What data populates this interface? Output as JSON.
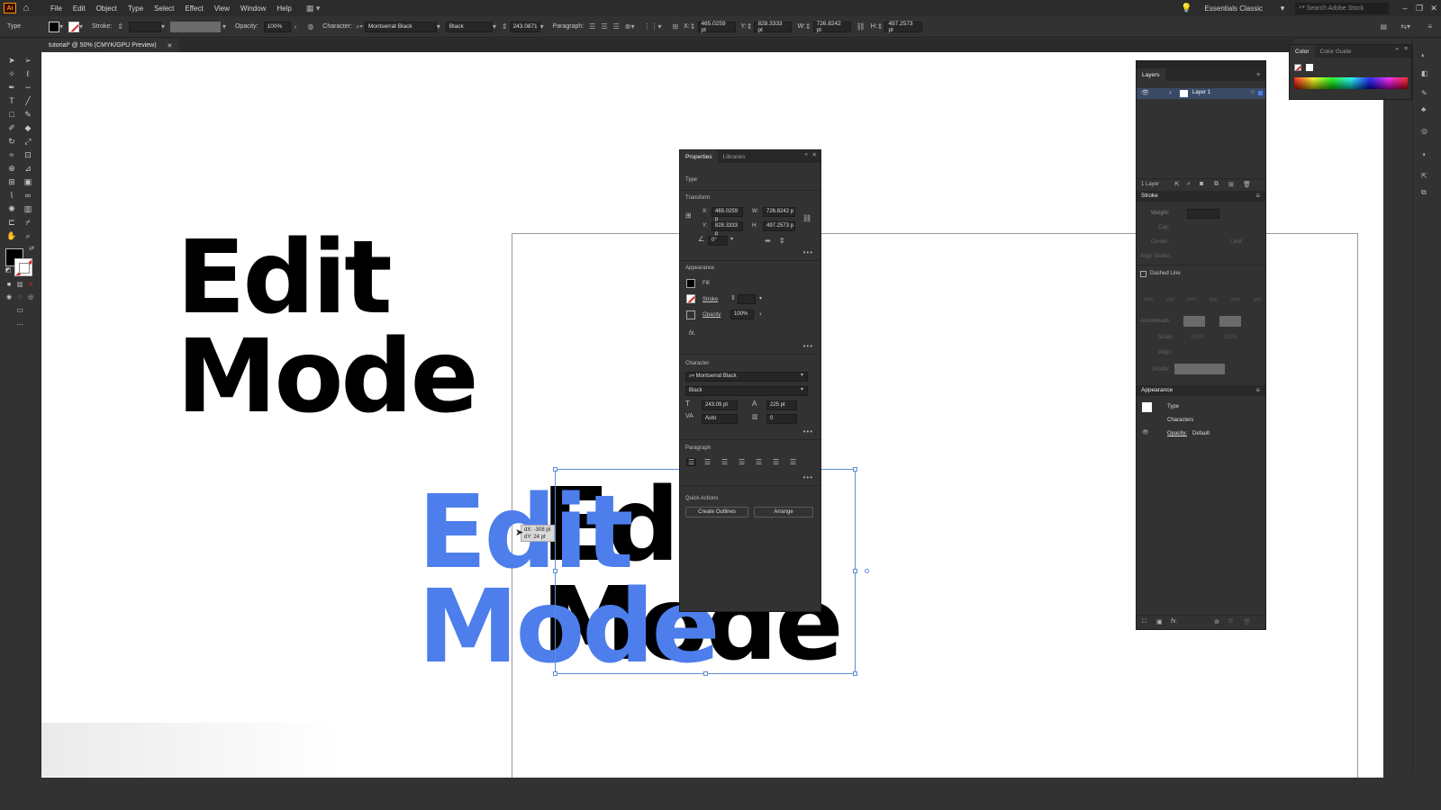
{
  "app": {
    "logo": "Ai"
  },
  "menu": [
    "File",
    "Edit",
    "Object",
    "Type",
    "Select",
    "Effect",
    "View",
    "Window",
    "Help"
  ],
  "menubar_right": {
    "workspace": "Essentials Classic",
    "search_placeholder": "Search Adobe Stock"
  },
  "control": {
    "mode": "Type",
    "stroke_label": "Stroke:",
    "opacity_label": "Opacity:",
    "opacity_value": "100%",
    "character_label": "Character:",
    "font": "Montserrat Black",
    "style": "Black",
    "size": "243.0871",
    "paragraph_label": "Paragraph:",
    "x_label": "X:",
    "x": "465.0259 pt",
    "y_label": "Y:",
    "y": "828.3333 pt",
    "w_label": "W:",
    "w": "726.8242 pt",
    "h_label": "H:",
    "h": "497.2573 pt"
  },
  "document_tab": {
    "title": "tutorial* @ 50% (CMYK/GPU Preview)"
  },
  "canvas": {
    "top_line1": "Edit",
    "top_line2": "Mode",
    "black_line1": "Edit",
    "black_line2": "Mode",
    "blue_line1": "Edit",
    "blue_line2": "Mode",
    "tooltip_dx": "dX: -308 pt",
    "tooltip_dy": "dY: 24 pt",
    "colors": {
      "blue": "#4d7eeb",
      "black": "#000000"
    }
  },
  "properties": {
    "tabs": [
      "Properties",
      "Libraries"
    ],
    "type_label": "Type",
    "transform_label": "Transform",
    "x_label": "X:",
    "x": "465.0259 p",
    "y_label": "Y:",
    "y": "828.3333 p",
    "w_label": "W:",
    "w": "726.8242 p",
    "h_label": "H:",
    "h": "497.2573 p",
    "angle": "0°",
    "appearance_label": "Appearance",
    "fill_label": "Fill",
    "stroke_label": "Stroke",
    "opacity_label": "Opacity",
    "opacity_value": "100%",
    "fx_label": "fx.",
    "character_label": "Character",
    "font": "Montserrat Black",
    "style": "Black",
    "size": "243.09 pt",
    "leading": "225 pt",
    "kerning": "Auto",
    "tracking": "0",
    "paragraph_label": "Paragraph",
    "quick_actions_label": "Quick Actions",
    "create_outlines": "Create Outlines",
    "arrange": "Arrange"
  },
  "layers": {
    "title": "Layers",
    "layer_name": "Layer 1",
    "count": "1 Layer",
    "stroke_title": "Stroke",
    "weight_label": "Weight:",
    "cap_label": "Cap:",
    "corner_label": "Corner:",
    "limit_label": "Limit:",
    "align_stroke_label": "Align Stroke:",
    "dashed_line": "Dashed Line",
    "dash_labels": [
      "dash",
      "gap",
      "dash",
      "gap",
      "dash",
      "gap"
    ],
    "arrowheads_label": "Arrowheads:",
    "scale_label": "Scale:",
    "scale_1": "100%",
    "scale_2": "100%",
    "align_label": "Align:",
    "profile_label": "Profile:",
    "appearance_title": "Appearance",
    "type_row": "Type",
    "characters_row": "Characters",
    "opacity_row_label": "Opacity:",
    "opacity_row_value": "Default"
  },
  "color_panel": {
    "tabs": [
      "Color",
      "Color Guide"
    ]
  }
}
